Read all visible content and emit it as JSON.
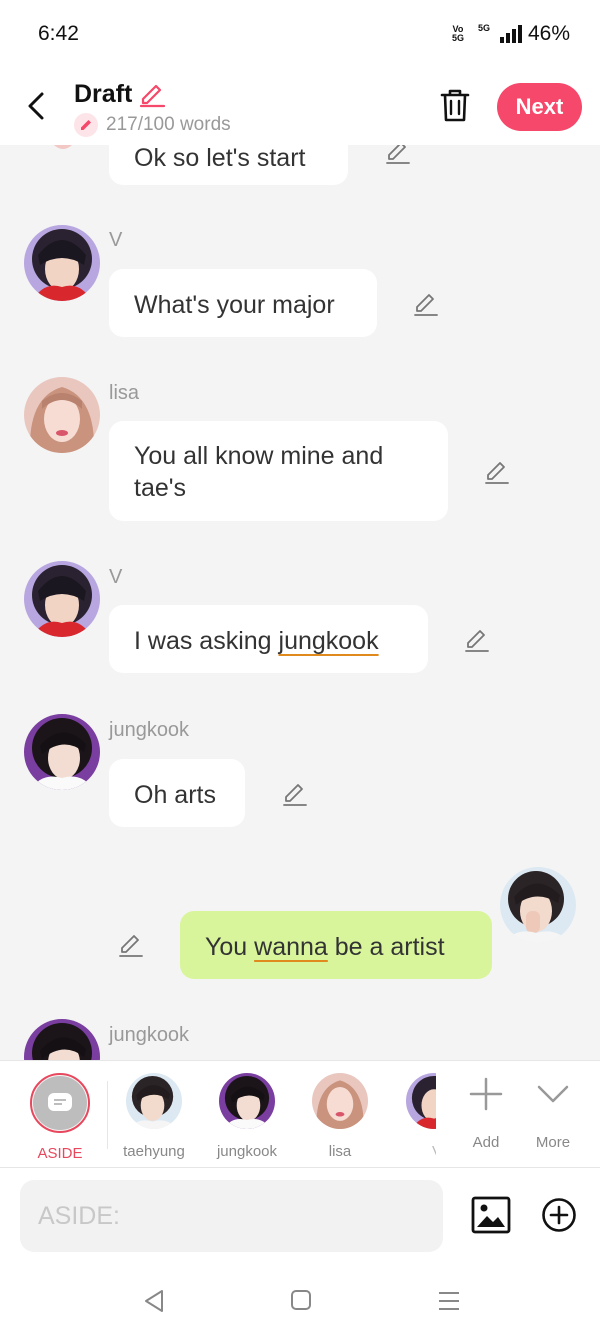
{
  "status": {
    "time": "6:42",
    "network_top": "Vo",
    "network_bottom": "5G",
    "signal_label": "5G",
    "battery": "46%"
  },
  "header": {
    "title": "Draft",
    "word_count": "217/100 words",
    "next_label": "Next"
  },
  "messages": [
    {
      "sender": "",
      "text": "Ok so let's start",
      "side": "left"
    },
    {
      "sender": "V",
      "text": "What's your major",
      "side": "left"
    },
    {
      "sender": "lisa",
      "text": "You all know mine and tae's",
      "side": "left"
    },
    {
      "sender": "V",
      "text_before": "I was asking ",
      "text_underlined": "jungkook",
      "side": "left"
    },
    {
      "sender": "jungkook",
      "text": "Oh arts",
      "side": "left"
    },
    {
      "sender": "taehyung",
      "text_before": "You ",
      "text_underlined": "wanna",
      "text_after": " be a artist",
      "side": "right"
    },
    {
      "sender": "jungkook",
      "side": "left"
    }
  ],
  "characters": [
    {
      "label": "ASIDE",
      "selected": true
    },
    {
      "label": "taehyung"
    },
    {
      "label": "jungkook"
    },
    {
      "label": "lisa"
    },
    {
      "label": "V"
    }
  ],
  "actions": {
    "add_label": "Add",
    "more_label": "More"
  },
  "input": {
    "placeholder": "ASIDE:"
  },
  "colors": {
    "accent": "#f5486a",
    "bubble_right": "#d8f59c",
    "background": "#f4f4f4"
  }
}
